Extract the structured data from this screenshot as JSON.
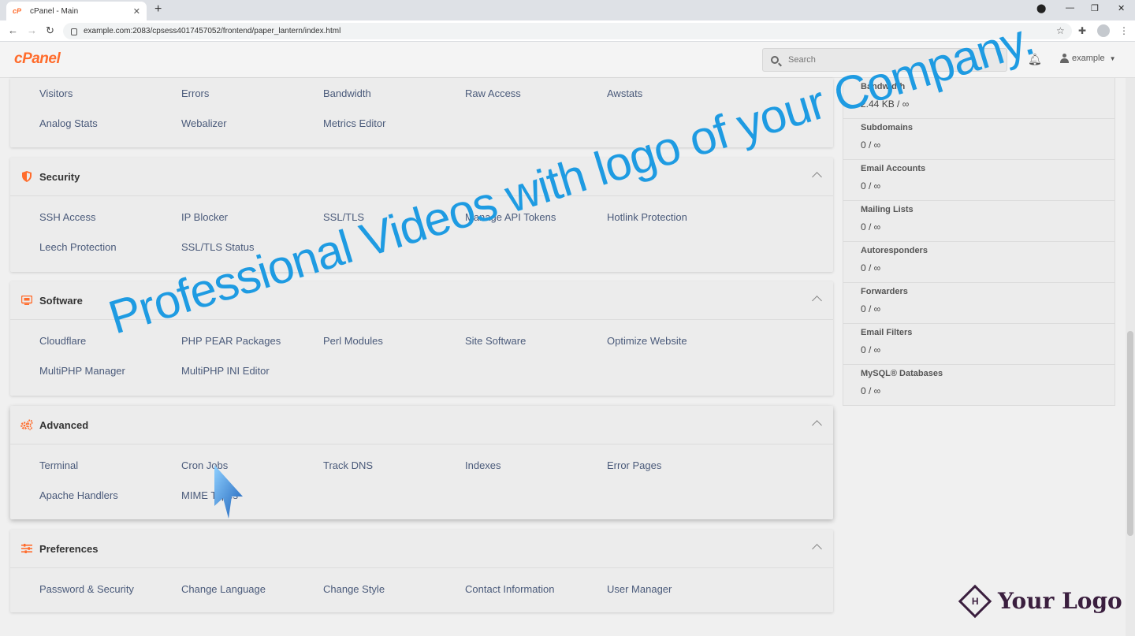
{
  "browser": {
    "tab_title": "cPanel - Main",
    "tab_favicon": "cP",
    "url": "example.com:2083/cpsess4017457052/frontend/paper_lantern/index.html"
  },
  "header": {
    "logo": "cPanel",
    "search_placeholder": "Search",
    "username": "example"
  },
  "sections": {
    "metrics": {
      "items": [
        "Visitors",
        "Errors",
        "Bandwidth",
        "Raw Access",
        "Awstats",
        "Analog Stats",
        "Webalizer",
        "Metrics Editor"
      ]
    },
    "security": {
      "title": "Security",
      "items": [
        "SSH Access",
        "IP Blocker",
        "SSL/TLS",
        "Manage API Tokens",
        "Hotlink Protection",
        "Leech Protection",
        "SSL/TLS Status"
      ]
    },
    "software": {
      "title": "Software",
      "items": [
        "Cloudflare",
        "PHP PEAR Packages",
        "Perl Modules",
        "Site Software",
        "Optimize Website",
        "MultiPHP Manager",
        "MultiPHP INI Editor"
      ]
    },
    "advanced": {
      "title": "Advanced",
      "items": [
        "Terminal",
        "Cron Jobs",
        "Track DNS",
        "Indexes",
        "Error Pages",
        "Apache Handlers",
        "MIME Types"
      ]
    },
    "preferences": {
      "title": "Preferences",
      "items": [
        "Password & Security",
        "Change Language",
        "Change Style",
        "Contact Information",
        "User Manager"
      ]
    }
  },
  "stats": [
    {
      "label": "Bandwidth",
      "value": "2.44 KB / ∞"
    },
    {
      "label": "Subdomains",
      "value": "0 / ∞"
    },
    {
      "label": "Email Accounts",
      "value": "0 / ∞"
    },
    {
      "label": "Mailing Lists",
      "value": "0 / ∞"
    },
    {
      "label": "Autoresponders",
      "value": "0 / ∞"
    },
    {
      "label": "Forwarders",
      "value": "0 / ∞"
    },
    {
      "label": "Email Filters",
      "value": "0 / ∞"
    },
    {
      "label": "MySQL® Databases",
      "value": "0 / ∞"
    }
  ],
  "overlay": {
    "watermark": "Professional Videos with logo of your Company.",
    "logo_text": "Your Logo",
    "logo_mark": "H"
  },
  "colors": {
    "accent": "#ff6c2c",
    "link": "#4a5a7a",
    "watermark": "#1e9be2"
  }
}
